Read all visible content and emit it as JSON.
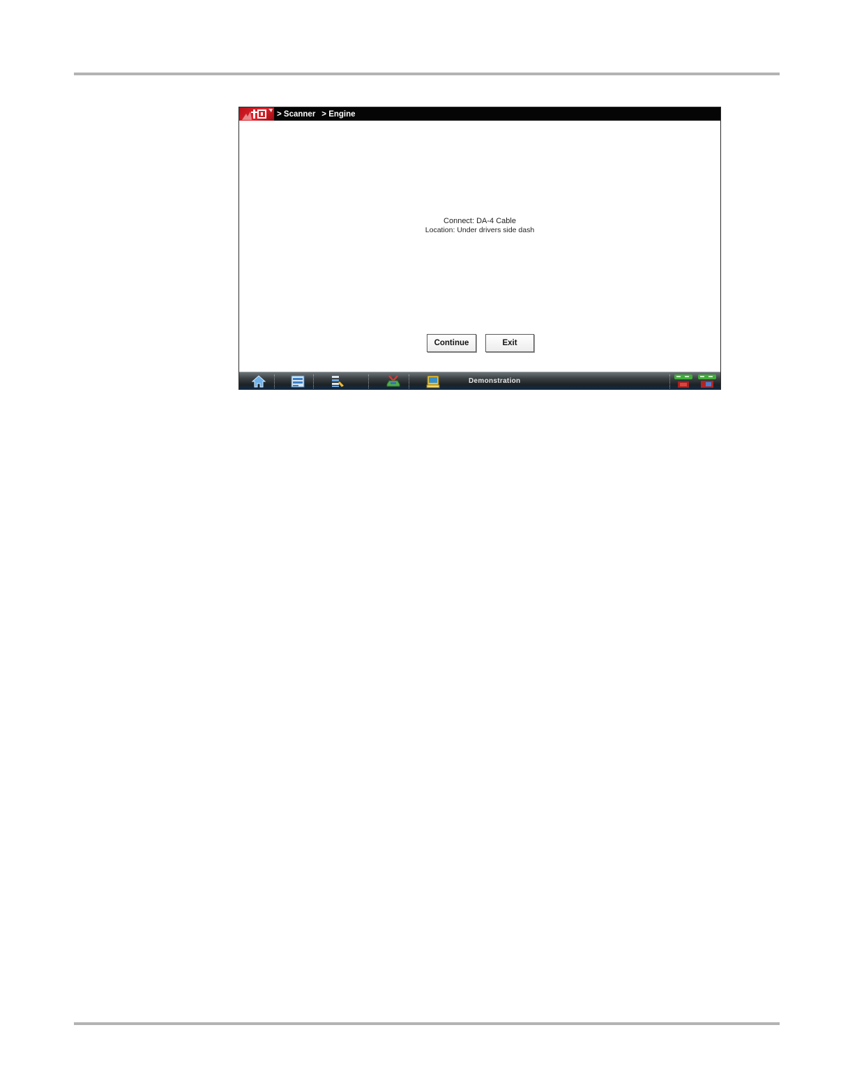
{
  "window": {
    "breadcrumbs": [
      "> Scanner",
      "> Engine"
    ]
  },
  "message": {
    "line1": "Connect: DA-4 Cable",
    "line2": "Location: Under drivers side dash"
  },
  "buttons": {
    "continue_label": "Continue",
    "exit_label": "Exit"
  },
  "toolbar": {
    "icons": [
      "home-icon",
      "scanner-icon",
      "data-list-icon",
      "vehicle-icon",
      "tools-icon"
    ],
    "status": "Demonstration",
    "indicators": [
      "connection-status-icon",
      "battery-status-icon"
    ]
  },
  "colors": {
    "title_bar": "#050505",
    "logo_red": "#e0242c",
    "toolbar_dark": "#1d2224",
    "indicator_green": "#3fae3a"
  }
}
